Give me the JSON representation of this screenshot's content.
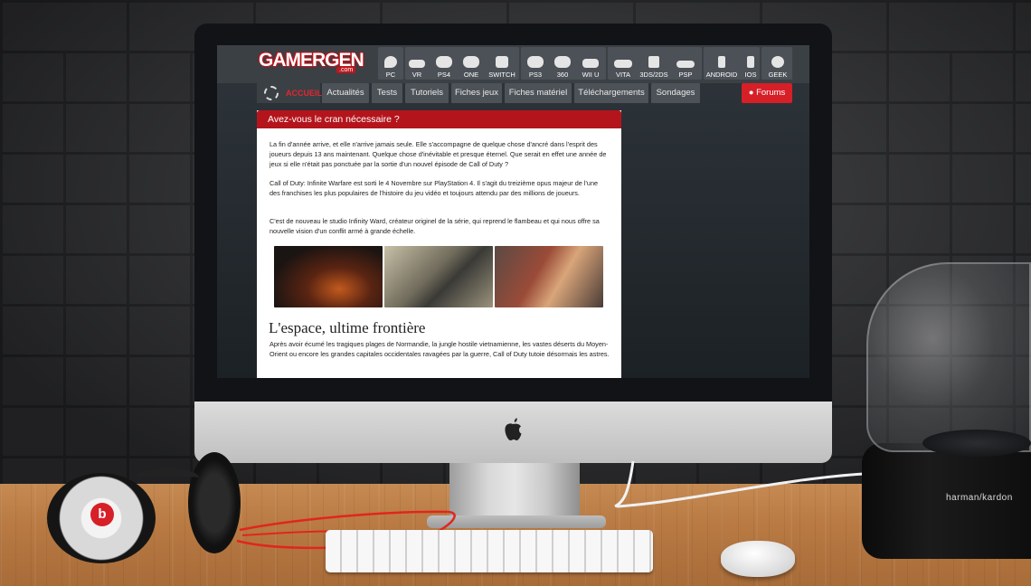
{
  "site": {
    "logo_text": "GAMERGEN",
    "logo_suffix": ".com",
    "platforms": [
      {
        "label": "PC",
        "icon": "pc-icon"
      },
      {
        "label": "VR",
        "icon": "vr-headset-icon"
      },
      {
        "label": "PS4",
        "icon": "gamepad-icon"
      },
      {
        "label": "ONE",
        "icon": "gamepad-icon"
      },
      {
        "label": "SWITCH",
        "icon": "switch-icon"
      },
      {
        "label": "PS3",
        "icon": "gamepad-icon"
      },
      {
        "label": "360",
        "icon": "gamepad-icon"
      },
      {
        "label": "WII U",
        "icon": "wiiu-icon"
      },
      {
        "label": "VITA",
        "icon": "handheld-icon"
      },
      {
        "label": "3DS/2DS",
        "icon": "ds-icon"
      },
      {
        "label": "PSP",
        "icon": "psp-icon"
      },
      {
        "label": "ANDROID",
        "icon": "phone-icon"
      },
      {
        "label": "IOS",
        "icon": "phone-icon"
      },
      {
        "label": "GEEK",
        "icon": "geek-icon"
      }
    ],
    "nav": {
      "home": "ACCUEIL",
      "items": [
        "Actualités",
        "Tests",
        "Tutoriels",
        "Fiches jeux",
        "Fiches matériel",
        "Téléchargements",
        "Sondages"
      ],
      "forums": "Forums"
    }
  },
  "article": {
    "title": "Avez-vous le cran nécessaire ?",
    "paragraphs": [
      "La fin d'année arrive, et elle n'arrive jamais seule. Elle s'accompagne de quelque chose d'ancré dans l'esprit des joueurs depuis 13 ans maintenant. Quelque chose d'inévitable et presque éternel. Que serait en effet une année de jeux si elle n'était pas ponctuée par la sortie d'un nouvel épisode de Call of Duty ?",
      "Call of Duty: Infinite Warfare est sorti le 4 Novembre sur PlayStation 4. Il s'agit du treizième opus majeur de l'une des franchises les plus populaires de l'histoire du jeu vidéo et toujours attendu par des millions de joueurs.",
      "C'est de nouveau le studio Infinity Ward, créateur originel de la série, qui reprend le flambeau et qui nous offre sa nouvelle vision d'un conflit armé à grande échelle."
    ],
    "subheading": "L'espace, ultime frontière",
    "sub_paragraph": "Après avoir écumé les tragiques plages de Normandie, la jungle hostile vietnamienne, les vastes déserts du Moyen-Orient ou encore les grandes capitales occidentales ravagées par la guerre, Call of Duty tutoie désormais les astres."
  },
  "speaker": {
    "brand": "harman/kardon"
  },
  "colors": {
    "accent": "#b4151c",
    "forum_button": "#d71f28",
    "nav_bg": "#4c5257"
  }
}
